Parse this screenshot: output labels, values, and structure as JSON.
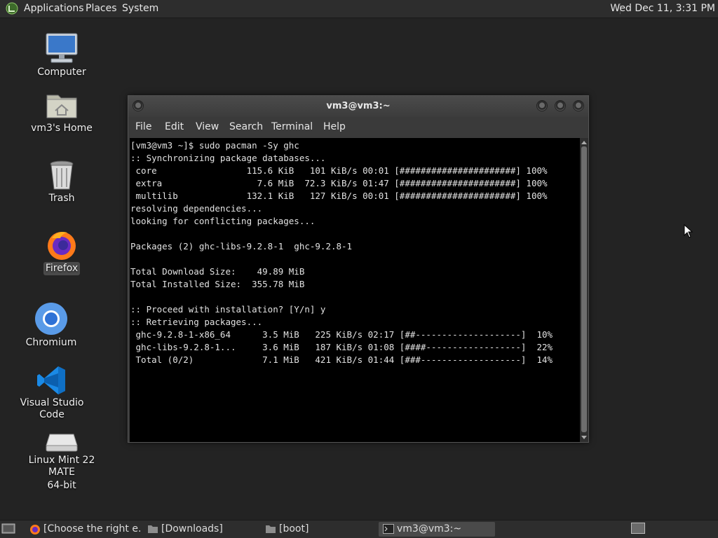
{
  "top_panel": {
    "menus": [
      "Applications",
      "Places",
      "System"
    ],
    "clock": "Wed Dec 11,  3:31 PM"
  },
  "desktop_icons": [
    {
      "label": "Computer",
      "icon": "computer-icon"
    },
    {
      "label": "vm3's Home",
      "icon": "home-folder-icon"
    },
    {
      "label": "Trash",
      "icon": "trash-icon"
    },
    {
      "label": "Firefox",
      "icon": "firefox-icon"
    },
    {
      "label": "Chromium",
      "icon": "chromium-icon"
    },
    {
      "label": "Visual Studio Code",
      "icon": "vscode-icon"
    },
    {
      "label_line1": "Linux Mint 22 MATE",
      "label_line2": "64-bit",
      "icon": "disc-drive-icon"
    }
  ],
  "terminal": {
    "title": "vm3@vm3:~",
    "menu": [
      "File",
      "Edit",
      "View",
      "Search",
      "Terminal",
      "Help"
    ],
    "output": "[vm3@vm3 ~]$ sudo pacman -Sy ghc\n:: Synchronizing package databases...\n core                 115.6 KiB   101 KiB/s 00:01 [######################] 100%\n extra                  7.6 MiB  72.3 KiB/s 01:47 [######################] 100%\n multilib             132.1 KiB   127 KiB/s 00:01 [######################] 100%\nresolving dependencies...\nlooking for conflicting packages...\n\nPackages (2) ghc-libs-9.2.8-1  ghc-9.2.8-1\n\nTotal Download Size:    49.89 MiB\nTotal Installed Size:  355.78 MiB\n\n:: Proceed with installation? [Y/n] y\n:: Retrieving packages...\n ghc-9.2.8-1-x86_64      3.5 MiB   225 KiB/s 02:17 [##--------------------]  10%\n ghc-libs-9.2.8-1...     3.6 MiB   187 KiB/s 01:08 [####------------------]  22%\n Total (0/2)             7.1 MiB   421 KiB/s 01:44 [###-------------------]  14%"
  },
  "taskbar": {
    "items": [
      {
        "label": "[Choose the right e...",
        "icon": "firefox-icon"
      },
      {
        "label": "[Downloads]",
        "icon": "folder-icon"
      },
      {
        "label": "[boot]",
        "icon": "folder-icon"
      },
      {
        "label": "vm3@vm3:~",
        "icon": "terminal-icon",
        "active": true
      }
    ]
  },
  "colors": {
    "desktop_bg": "#232323",
    "panel_bg": "#2d2d2d",
    "terminal_bg": "#000000",
    "terminal_fg": "#e2e2e2"
  }
}
